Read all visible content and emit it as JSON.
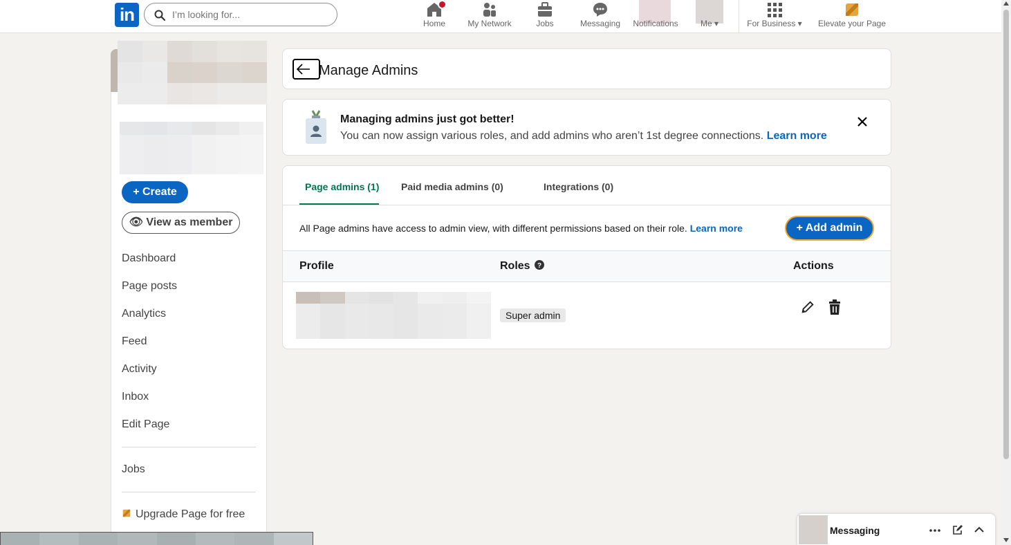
{
  "topnav": {
    "search_placeholder": "I’m looking for...",
    "items": [
      {
        "label": "Home",
        "icon": "home-icon"
      },
      {
        "label": "My Network",
        "icon": "network-icon"
      },
      {
        "label": "Jobs",
        "icon": "jobs-icon"
      },
      {
        "label": "Messaging",
        "icon": "messaging-icon"
      },
      {
        "label": "Notifications",
        "icon": "notifications-icon"
      },
      {
        "label": "Me",
        "icon": "me-icon"
      },
      {
        "label": "For Business",
        "icon": "grid-icon"
      },
      {
        "label": "Elevate your Page",
        "icon": "premium-icon"
      }
    ]
  },
  "sidebar": {
    "create_label": "Create",
    "view_member_label": "View as member",
    "links": [
      "Dashboard",
      "Page posts",
      "Analytics",
      "Feed",
      "Activity",
      "Inbox",
      "Edit Page"
    ],
    "jobs_label": "Jobs",
    "upgrade_label": "Upgrade Page for free"
  },
  "header": {
    "title": "Manage Admins"
  },
  "banner": {
    "title": "Managing admins just got better!",
    "text": "You can now assign various roles, and add admins who aren’t 1st degree connections.",
    "link": "Learn more"
  },
  "admins": {
    "tabs": [
      "Page admins (1)",
      "Paid media admins (0)",
      "Integrations (0)"
    ],
    "info_text": "All Page admins have access to admin view, with different permissions based on their role.",
    "info_link": "Learn more",
    "add_label": "Add admin",
    "columns": [
      "Profile",
      "Roles",
      "Actions"
    ],
    "rows": [
      {
        "role": "Super admin"
      }
    ]
  },
  "messaging": {
    "title": "Messaging"
  },
  "colors": {
    "primary": "#0a66c2",
    "active_tab": "#01754f",
    "focus_ring": "#f5a623",
    "notification_badge": "#cb112d"
  }
}
